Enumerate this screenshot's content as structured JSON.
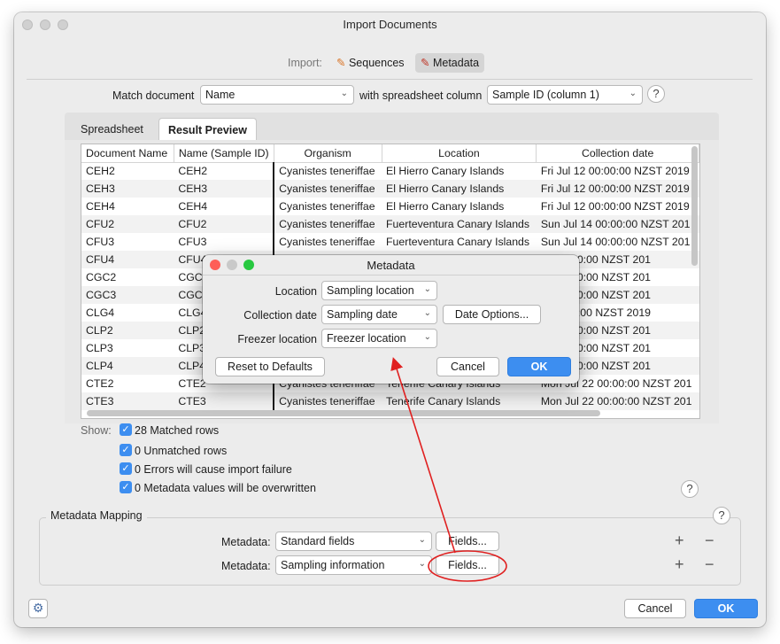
{
  "window": {
    "title": "Import Documents"
  },
  "import_bar": {
    "label": "Import:",
    "sequences": "Sequences",
    "metadata": "Metadata"
  },
  "match": {
    "label": "Match document",
    "document_field": "Name",
    "with_label": "with spreadsheet column",
    "column": "Sample ID (column 1)"
  },
  "tabs": {
    "spreadsheet": "Spreadsheet",
    "result_preview": "Result Preview"
  },
  "table": {
    "headers": [
      "Document Name",
      "Name (Sample ID)",
      "Organism",
      "Location",
      "Collection date"
    ],
    "rows": [
      [
        "CEH2",
        "CEH2",
        "Cyanistes teneriffae",
        "El Hierro Canary Islands",
        "Fri Jul 12 00:00:00 NZST 2019"
      ],
      [
        "CEH3",
        "CEH3",
        "Cyanistes teneriffae",
        "El Hierro Canary Islands",
        "Fri Jul 12 00:00:00 NZST 2019"
      ],
      [
        "CEH4",
        "CEH4",
        "Cyanistes teneriffae",
        "El Hierro Canary Islands",
        "Fri Jul 12 00:00:00 NZST 2019"
      ],
      [
        "CFU2",
        "CFU2",
        "Cyanistes teneriffae",
        "Fuerteventura Canary Islands",
        "Sun Jul 14 00:00:00 NZST 201"
      ],
      [
        "CFU3",
        "CFU3",
        "Cyanistes teneriffae",
        "Fuerteventura Canary Islands",
        "Sun Jul 14 00:00:00 NZST 201"
      ],
      [
        "CFU4",
        "CFU4",
        "",
        "",
        "14 00:00:00 NZST 201"
      ],
      [
        "CGC2",
        "CGC",
        "",
        "",
        "15 00:00:00 NZST 201"
      ],
      [
        "CGC3",
        "CGC",
        "",
        "",
        "15 00:00:00 NZST 201"
      ],
      [
        "CLG4",
        "CLG4",
        "",
        "",
        "9 00:00:00 NZST 2019"
      ],
      [
        "CLP2",
        "CLP2",
        "",
        "",
        "21 00:00:00 NZST 201"
      ],
      [
        "CLP3",
        "CLP3",
        "",
        "",
        "21 00:00:00 NZST 201"
      ],
      [
        "CLP4",
        "CLP4",
        "",
        "",
        "21 00:00:00 NZST 201"
      ],
      [
        "CTE2",
        "CTE2",
        "Cyanistes teneriffae",
        "Tenerife Canary Islands",
        "Mon Jul 22 00:00:00 NZST 201"
      ],
      [
        "CTE3",
        "CTE3",
        "Cyanistes teneriffae",
        "Tenerife Canary Islands",
        "Mon Jul 22 00:00:00 NZST 201"
      ]
    ]
  },
  "show": {
    "label": "Show:",
    "options": [
      {
        "label": "28 Matched rows",
        "checked": true
      },
      {
        "label": "0 Unmatched rows",
        "checked": true
      },
      {
        "label": "0 Errors will cause import failure",
        "checked": true
      },
      {
        "label": "0 Metadata values will be overwritten",
        "checked": true
      }
    ]
  },
  "mapping": {
    "title": "Metadata Mapping",
    "rows": [
      {
        "label": "Metadata:",
        "value": "Standard fields",
        "button": "Fields..."
      },
      {
        "label": "Metadata:",
        "value": "Sampling information",
        "button": "Fields..."
      }
    ]
  },
  "footer": {
    "cancel": "Cancel",
    "ok": "OK"
  },
  "dialog": {
    "title": "Metadata",
    "fields": [
      {
        "label": "Location",
        "value": "Sampling location"
      },
      {
        "label": "Collection date",
        "value": "Sampling date"
      },
      {
        "label": "Freezer location",
        "value": "Freezer location"
      }
    ],
    "date_options": "Date Options...",
    "reset": "Reset to Defaults",
    "cancel": "Cancel",
    "ok": "OK"
  },
  "icons": {
    "help": "?",
    "chevron": "⌄",
    "check": "✓",
    "plus": "+",
    "minus": "−",
    "gear": "⚙"
  },
  "colors": {
    "accent": "#3d8ef0",
    "annotation_red": "#e02020",
    "close_red": "#fe5f57",
    "minimize_yellow": "#febc2e",
    "zoom_green": "#28c840"
  }
}
